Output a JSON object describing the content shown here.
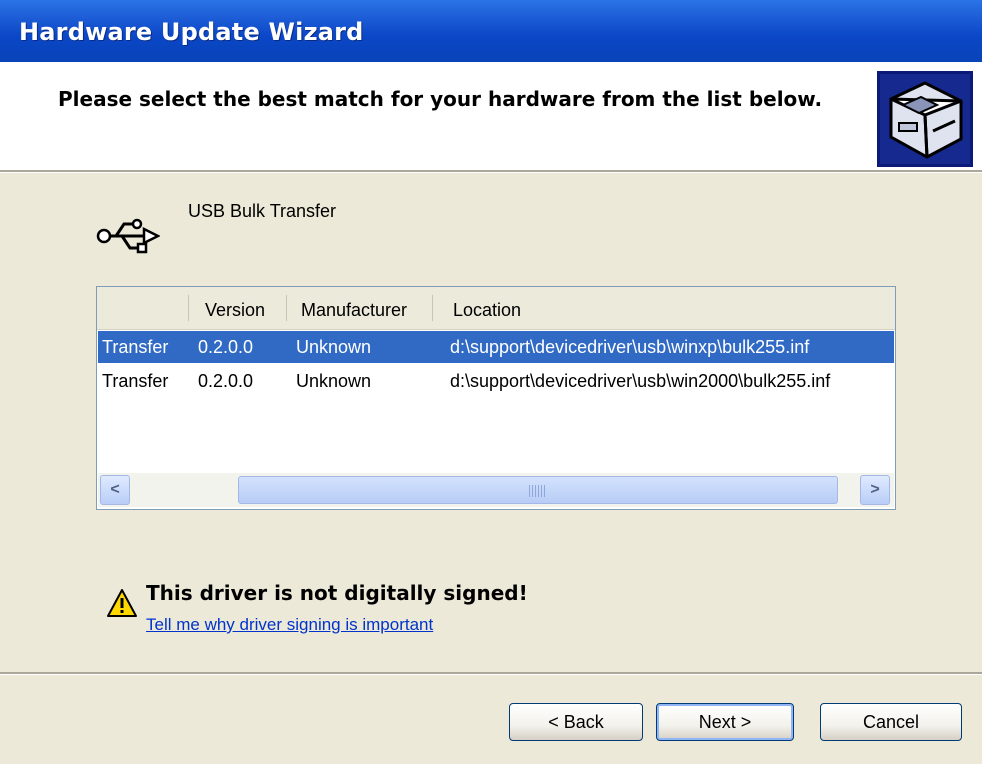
{
  "window": {
    "title": "Hardware Update Wizard"
  },
  "header": {
    "instruction": "Please select the best match for your hardware from the list below."
  },
  "device": {
    "name": "USB Bulk Transfer",
    "icon": "usb-icon"
  },
  "list": {
    "columns": [
      "",
      "Version",
      "Manufacturer",
      "Location"
    ],
    "rows": [
      {
        "name": "Transfer",
        "version": "0.2.0.0",
        "manufacturer": "Unknown",
        "location": "d:\\support\\devicedriver\\usb\\winxp\\bulk255.inf",
        "selected": true
      },
      {
        "name": "Transfer",
        "version": "0.2.0.0",
        "manufacturer": "Unknown",
        "location": "d:\\support\\devicedriver\\usb\\win2000\\bulk255.inf",
        "selected": false
      }
    ],
    "scrollbar": {
      "left_arrow": "<",
      "right_arrow": ">"
    }
  },
  "warning": {
    "message": "This driver is not digitally signed!",
    "link": "Tell me why driver signing is important",
    "icon": "warning-icon"
  },
  "buttons": {
    "back": "< Back",
    "next": "Next >",
    "cancel": "Cancel"
  },
  "colors": {
    "titlebar": "#0a46c6",
    "selection": "#316ac5",
    "link": "#0033cc"
  }
}
